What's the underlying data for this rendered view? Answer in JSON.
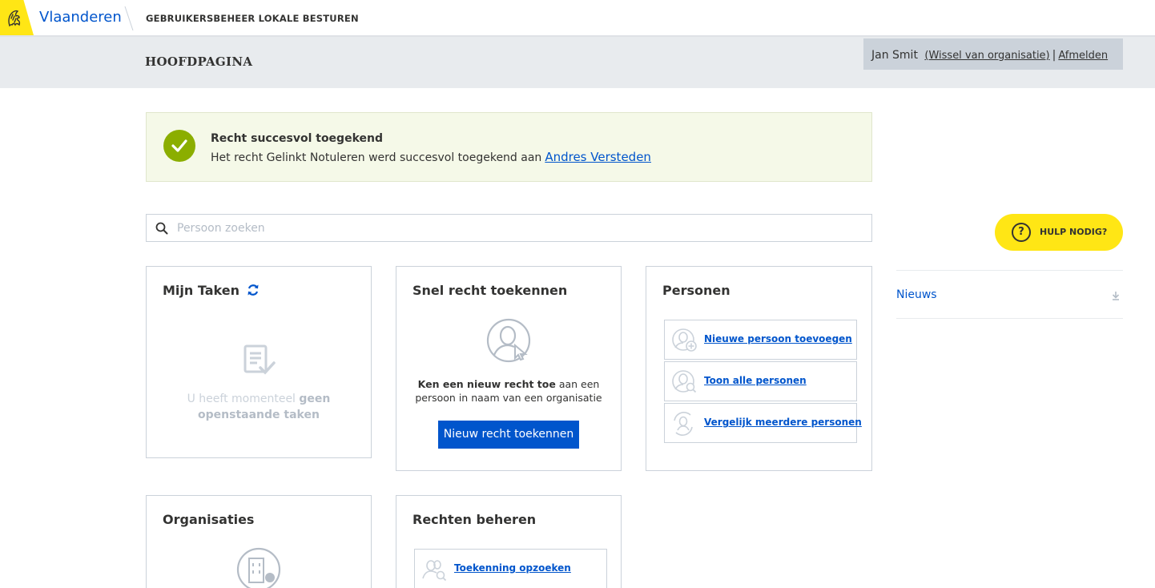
{
  "header": {
    "brand": "Vlaanderen",
    "app_name": "GEBRUIKERSBEHEER LOKALE BESTUREN"
  },
  "functional_header": {
    "title": "HOOFDPAGINA",
    "user_name": "Jan Smit",
    "switch_org": "(Wissel van organisatie)",
    "separator": "|",
    "logout": "Afmelden"
  },
  "alert": {
    "title": "Recht succesvol toegekend",
    "text": "Het recht Gelinkt Notuleren werd succesvol toegekend aan",
    "link": "Andres Versteden",
    "color": "#8bae00"
  },
  "search": {
    "placeholder": "Persoon zoeken",
    "value": ""
  },
  "help": {
    "icon": "?",
    "label": "HULP NODIG?"
  },
  "news": {
    "label": "Nieuws"
  },
  "cards": {
    "taken": {
      "title": "Mijn Taken",
      "empty_pre": "U heeft momenteel ",
      "empty_bold1": "geen",
      "empty_bold2": "openstaande taken"
    },
    "snel": {
      "title": "Snel recht toekennen",
      "text_bold": "Ken een nieuw recht toe",
      "text_rest": " aan een persoon in naam van een organisatie",
      "button": "Nieuw recht toekennen"
    },
    "personen": {
      "title": "Personen",
      "links": [
        {
          "label": "Nieuwe persoon toevoegen",
          "icon": "person-add-icon"
        },
        {
          "label": "Toon alle personen",
          "icon": "person-search-icon"
        },
        {
          "label": "Vergelijk meerdere personen",
          "icon": "person-compare-icon"
        }
      ]
    },
    "organisaties": {
      "title": "Organisaties"
    },
    "rechten": {
      "title": "Rechten beheren",
      "links": [
        {
          "label": "Toekenning opzoeken",
          "icon": "persons-search-icon"
        }
      ]
    }
  },
  "colors": {
    "brand_blue": "#0055cc",
    "flanders_yellow": "#ffe615",
    "header_grey": "#e8ebee",
    "user_box_grey": "#cbd2da"
  }
}
